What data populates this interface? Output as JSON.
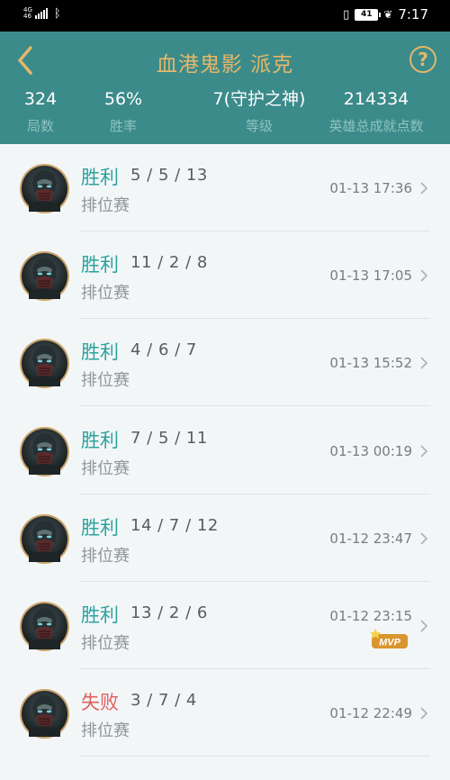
{
  "status_bar": {
    "network_top": "4G",
    "network_bottom": "46",
    "battery": "41",
    "time": "7:17"
  },
  "header": {
    "title": "血港鬼影 派克",
    "help_label": "?",
    "stats": [
      {
        "value": "324",
        "label": "局数"
      },
      {
        "value": "56%",
        "label": "胜率"
      },
      {
        "value": "7(守护之神)",
        "label": "等级"
      },
      {
        "value": "214334",
        "label": "英雄总成就点数"
      }
    ]
  },
  "matches": [
    {
      "result": "胜利",
      "outcome": "win",
      "kda": "5 / 5 / 13",
      "mode": "排位赛",
      "time": "01-13 17:36",
      "mvp": false
    },
    {
      "result": "胜利",
      "outcome": "win",
      "kda": "11 / 2 / 8",
      "mode": "排位赛",
      "time": "01-13 17:05",
      "mvp": false
    },
    {
      "result": "胜利",
      "outcome": "win",
      "kda": "4 / 6 / 7",
      "mode": "排位赛",
      "time": "01-13 15:52",
      "mvp": false
    },
    {
      "result": "胜利",
      "outcome": "win",
      "kda": "7 / 5 / 11",
      "mode": "排位赛",
      "time": "01-13 00:19",
      "mvp": false
    },
    {
      "result": "胜利",
      "outcome": "win",
      "kda": "14 / 7 / 12",
      "mode": "排位赛",
      "time": "01-12 23:47",
      "mvp": false
    },
    {
      "result": "胜利",
      "outcome": "win",
      "kda": "13 / 2 / 6",
      "mode": "排位赛",
      "time": "01-12 23:15",
      "mvp": true,
      "mvp_label": "MVP"
    },
    {
      "result": "失败",
      "outcome": "lose",
      "kda": "3 / 7 / 4",
      "mode": "排位赛",
      "time": "01-12 22:49",
      "mvp": false
    }
  ],
  "colors": {
    "header_bg": "#3b8b8a",
    "title_gold": "#e5b76a",
    "win": "#2aa3a0",
    "lose": "#e0605e"
  }
}
